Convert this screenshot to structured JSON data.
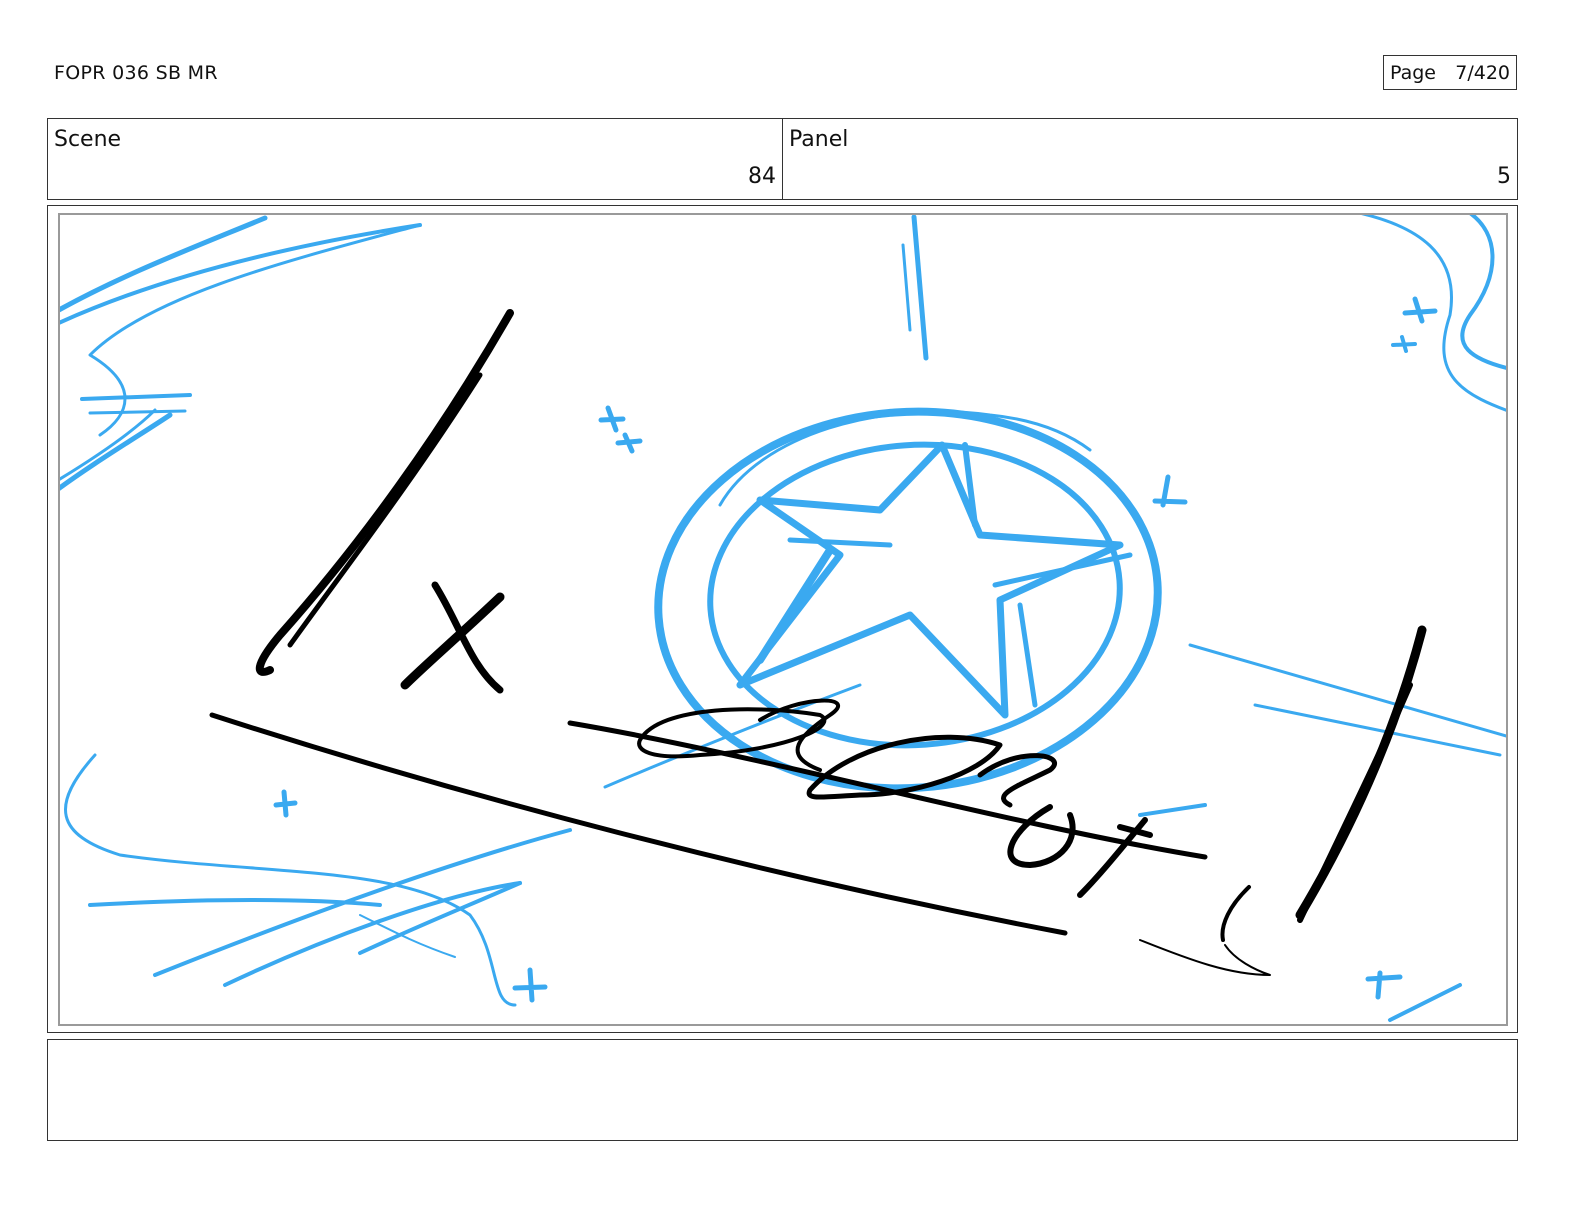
{
  "header": {
    "doc_id": "FOPR 036 SB MR",
    "page_label": "Page",
    "page_value": "7/420"
  },
  "info": {
    "scene_label": "Scene",
    "scene_value": "84",
    "panel_label": "Panel",
    "panel_value": "5"
  },
  "sketch": {
    "rough_color": "#3aa9f0",
    "ink_color": "#000000",
    "subject": "star-medallion"
  },
  "notes": {
    "text": ""
  }
}
